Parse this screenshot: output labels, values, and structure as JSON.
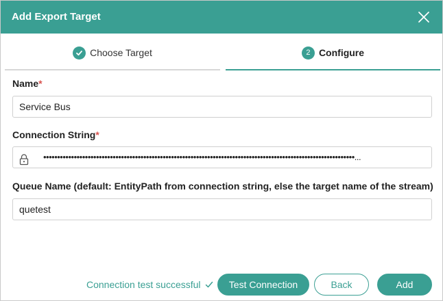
{
  "dialog": {
    "title": "Add Export Target",
    "close_icon": "close-icon"
  },
  "steps": [
    {
      "label": "Choose Target",
      "state": "complete",
      "icon": "check-icon"
    },
    {
      "label": "Configure",
      "number": "2",
      "state": "active"
    }
  ],
  "form": {
    "name": {
      "label": "Name",
      "required_mark": "*",
      "value": "Service Bus"
    },
    "connection_string": {
      "label": "Connection String",
      "required_mark": "*",
      "icon": "lock-icon",
      "masked_value": "••••••••••••••••••••••••••••••••••••••••••••••••••••••••••••••••••••••••••••••••••••••••••••••••••••••••••••••••..."
    },
    "queue_name": {
      "label": "Queue Name (default: EntityPath from connection string, else the target name of the stream)",
      "value": "quetest"
    }
  },
  "footer": {
    "status_text": "Connection test successful",
    "status_icon": "check-icon",
    "test_button": "Test Connection",
    "back_button": "Back",
    "add_button": "Add"
  },
  "colors": {
    "accent": "#3a9f93",
    "required": "#d9534f",
    "inactive_line": "#d7d7d7"
  }
}
